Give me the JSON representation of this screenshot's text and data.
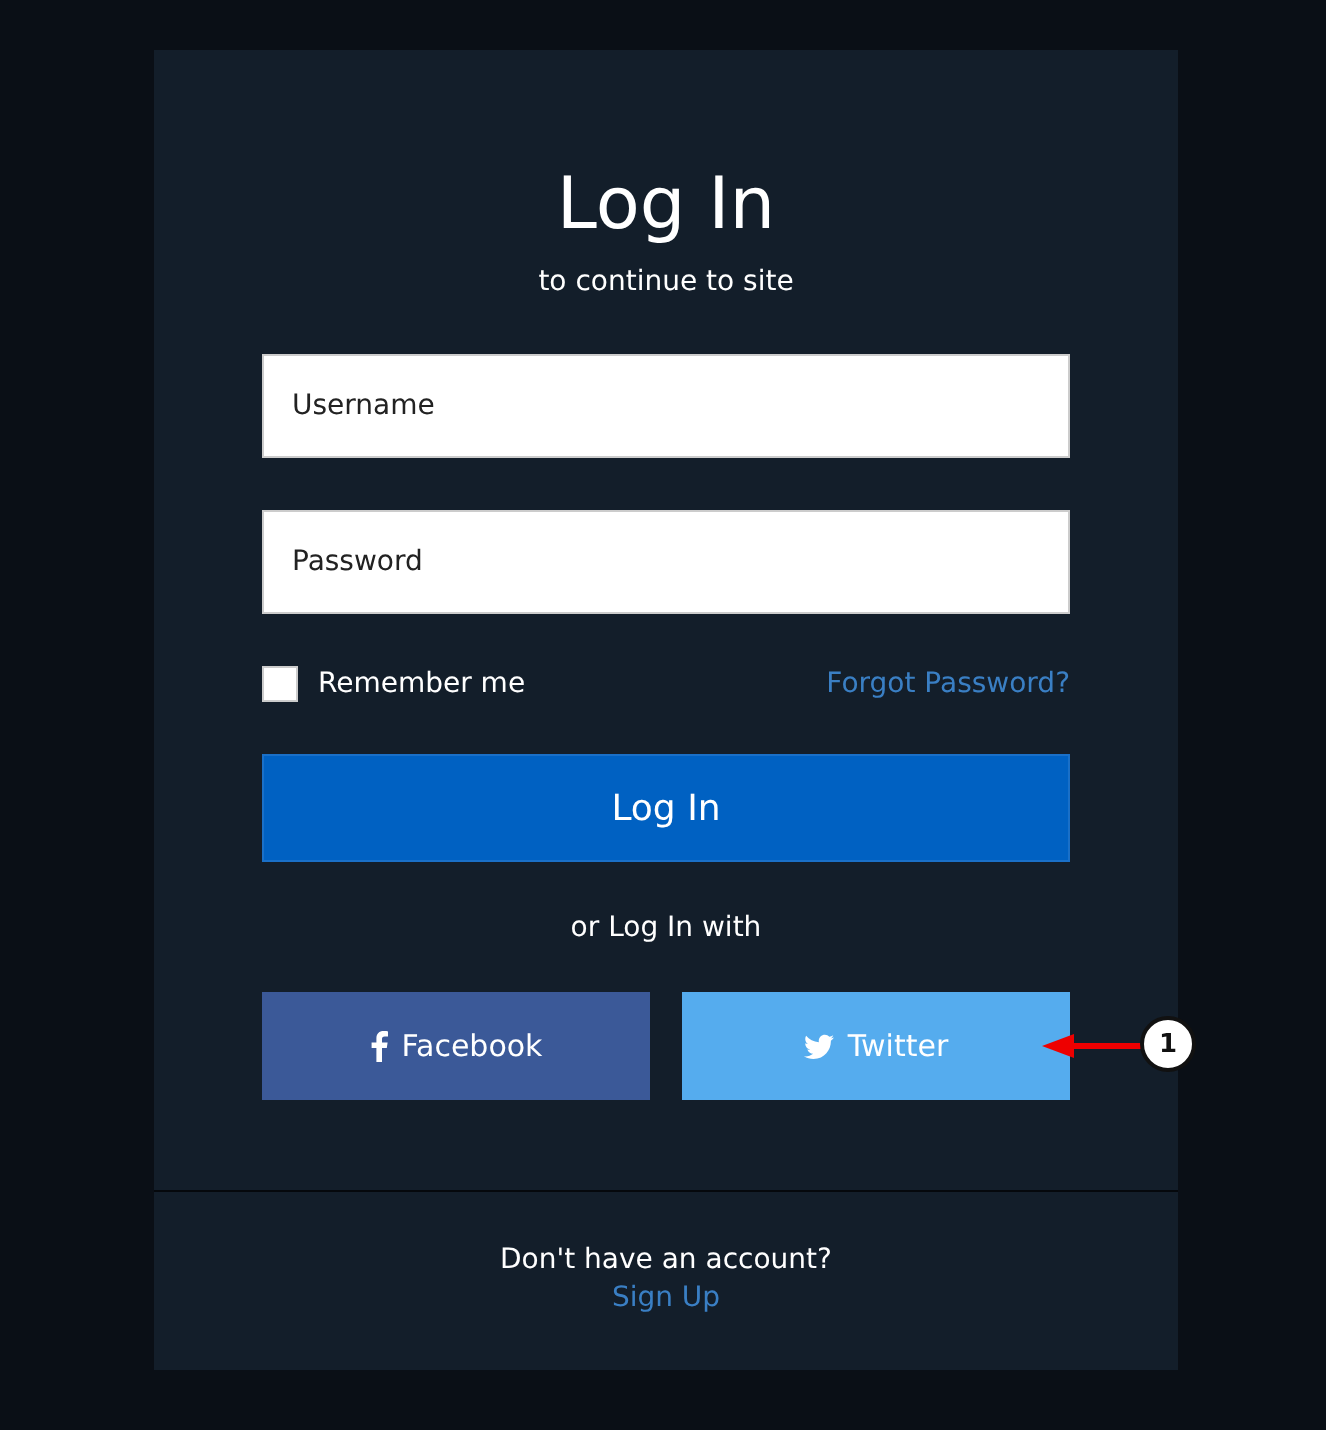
{
  "title": "Log In",
  "subtitle": "to continue to site",
  "fields": [
    {
      "placeholder": "Username"
    },
    {
      "placeholder": "Password"
    }
  ],
  "remember": {
    "label": "Remember me",
    "checked": false
  },
  "forgot_link": "Forgot Password?",
  "login_button": "Log In",
  "divider_text": "or Log In with",
  "social_buttons": [
    {
      "kind": "facebook",
      "label": "Facebook",
      "color": "#3b5998"
    },
    {
      "kind": "twitter",
      "label": "Twitter",
      "color": "#55acee"
    }
  ],
  "callout": {
    "label": "1"
  },
  "footer": {
    "text": "Don't have an account?",
    "link": "Sign Up"
  }
}
